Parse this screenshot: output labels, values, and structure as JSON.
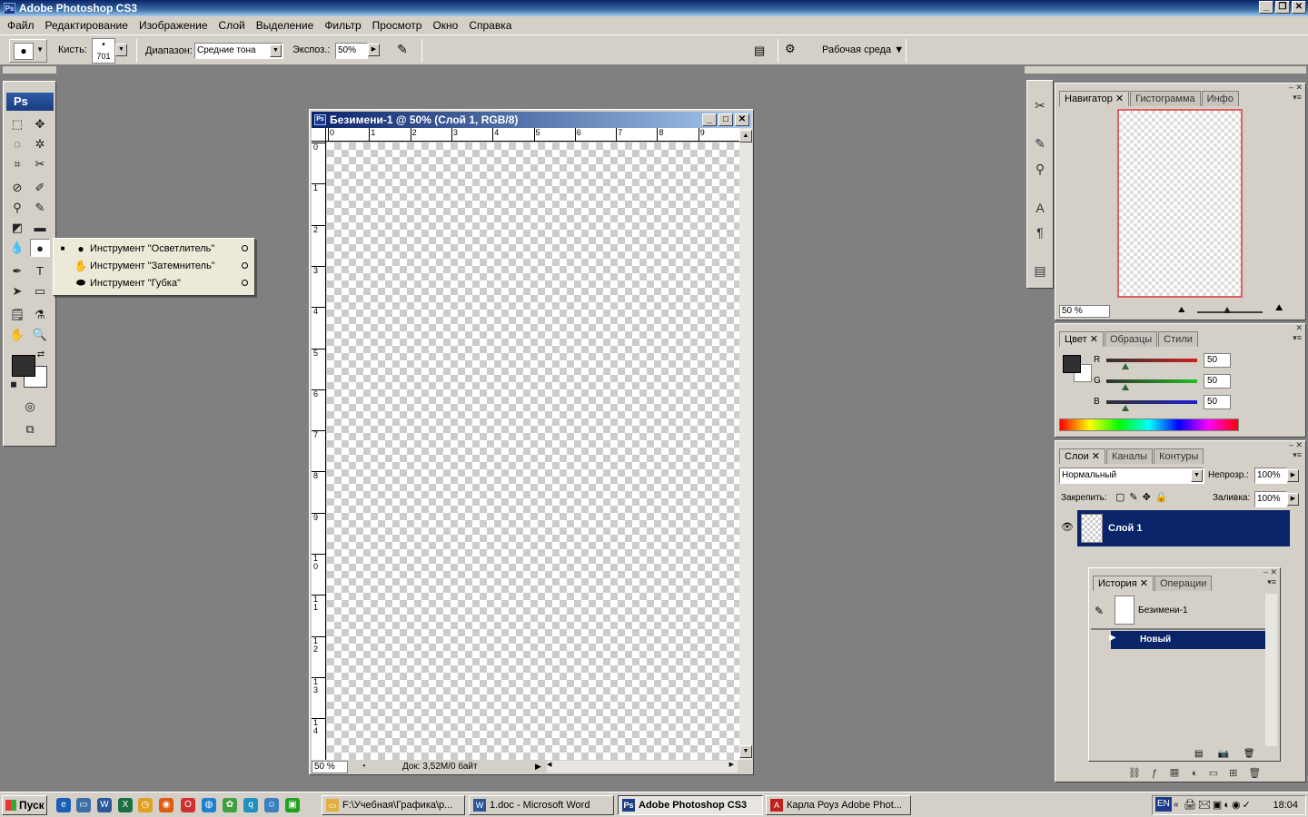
{
  "window": {
    "title": "Adobe Photoshop CS3"
  },
  "menu": [
    "Файл",
    "Редактирование",
    "Изображение",
    "Слой",
    "Выделение",
    "Фильтр",
    "Просмотр",
    "Окно",
    "Справка"
  ],
  "options": {
    "brush_label": "Кисть:",
    "brush_size": "701",
    "range_label": "Диапазон:",
    "range_value": "Средние тона",
    "exposure_label": "Экспоз.:",
    "exposure_value": "50%",
    "workspace_label": "Рабочая среда"
  },
  "flyout": {
    "items": [
      "Инструмент \"Осветлитель\"",
      "Инструмент \"Затемнитель\"",
      "Инструмент \"Губка\""
    ]
  },
  "document": {
    "title": "Безимени-1 @ 50% (Слой 1, RGB/8)",
    "zoom": "50 %",
    "status": "Док: 3,52M/0 байт",
    "ruler_h": [
      "0",
      "1",
      "2",
      "3",
      "4",
      "5",
      "6",
      "7",
      "8",
      "9"
    ],
    "ruler_v": [
      "0",
      "1",
      "2",
      "3",
      "4",
      "5",
      "6",
      "7",
      "8",
      "9",
      "1 0",
      "1 1",
      "1 2",
      "1 3",
      "1 4"
    ]
  },
  "navigator": {
    "tabs": [
      "Навигатор",
      "Гистограмма",
      "Инфо"
    ],
    "zoom": "50 %"
  },
  "color_panel": {
    "tabs": [
      "Цвет",
      "Образцы",
      "Стили"
    ],
    "channels": [
      {
        "label": "R",
        "value": "50",
        "color": "#d02020"
      },
      {
        "label": "G",
        "value": "50",
        "color": "#20c020"
      },
      {
        "label": "B",
        "value": "50",
        "color": "#2020d0"
      }
    ]
  },
  "layers_panel": {
    "tabs": [
      "Слои",
      "Каналы",
      "Контуры"
    ],
    "blend_mode": "Нормальный",
    "opacity_label": "Непрозр.:",
    "opacity_value": "100%",
    "lock_label": "Закрепить:",
    "fill_label": "Заливка:",
    "fill_value": "100%",
    "layer_name": "Слой 1"
  },
  "history_panel": {
    "tabs": [
      "История",
      "Операции"
    ],
    "snapshot": "Безимени-1",
    "step": "Новый"
  },
  "taskbar": {
    "start": "Пуск",
    "tasks": [
      "F:\\Учебная\\Графика\\р...",
      "1.doc - Microsoft Word",
      "Adobe Photoshop CS3",
      "Карла Роуз Adobe Phot..."
    ],
    "lang": "EN",
    "time": "18:04"
  }
}
